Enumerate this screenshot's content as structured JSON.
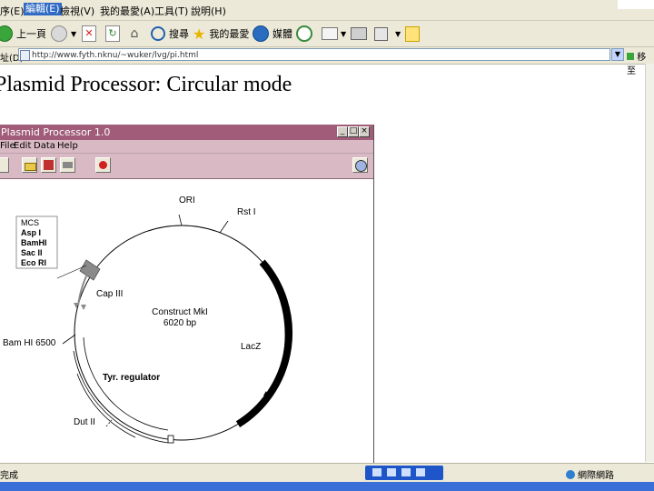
{
  "browser": {
    "menu": [
      "序(E)",
      "編輯(E)",
      "檢視(V)",
      "我的最愛(A)",
      "工具(T)",
      "說明(H)"
    ],
    "active_menu_index": 1,
    "toolbar": {
      "back_label": "上一頁",
      "search_label": "搜尋",
      "favorites_label": "我的最愛",
      "media_label": "媒體"
    },
    "address": {
      "label": "址(D)",
      "url": "http://www.fyth.nknu/~wuker/lvg/pi.html",
      "go_label": "移至"
    },
    "status": {
      "left": "完成",
      "zone": "網際網路"
    }
  },
  "page": {
    "heading": "Plasmid Processor: Circular mode"
  },
  "app": {
    "title": "Plasmid Processor 1.0",
    "menu": [
      "File",
      "Edit",
      "Data",
      "Help"
    ],
    "map": {
      "construct_name": "Construct MkI",
      "construct_size": "6020 bp",
      "mcs_box": [
        "MCS",
        "Asp I",
        "BamHI",
        "Sac II",
        "Eco RI"
      ],
      "labels": {
        "ori": "ORI",
        "rst": "Rst I",
        "cap": "Cap III",
        "bam": "Bam HI 6500",
        "lacz": "LacZ",
        "tyr": "Tyr. regulator",
        "dut": "Dut II"
      }
    }
  },
  "colors": {
    "xp_chrome": "#ece9d8",
    "app_titlebar": "#a05c78",
    "app_toolbar": "#d9b9c3",
    "taskbar": "#3a6fd8"
  }
}
